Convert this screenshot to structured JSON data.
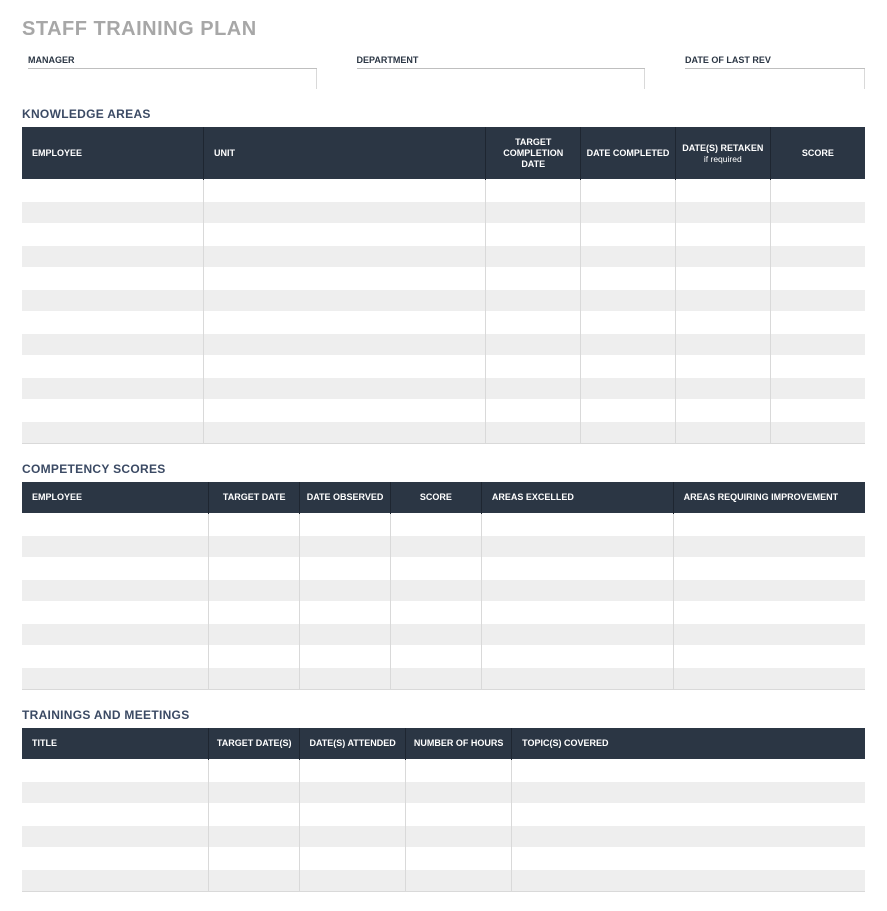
{
  "title": "STAFF TRAINING PLAN",
  "meta": {
    "manager_label": "MANAGER",
    "manager_value": "",
    "department_label": "DEPARTMENT",
    "department_value": "",
    "lastrev_label": "DATE OF LAST REV",
    "lastrev_value": ""
  },
  "knowledge": {
    "heading": "KNOWLEDGE AREAS",
    "headers": {
      "employee": "EMPLOYEE",
      "unit": "UNIT",
      "target_completion": "TARGET COMPLETION DATE",
      "date_completed": "DATE COMPLETED",
      "dates_retaken": "DATE(S) RETAKEN",
      "dates_retaken_sub": "if required",
      "score": "SCORE"
    },
    "rows": [
      {
        "employee": "",
        "unit": "",
        "target": "",
        "completed": "",
        "retaken": "",
        "score": ""
      },
      {
        "employee": "",
        "unit": "",
        "target": "",
        "completed": "",
        "retaken": "",
        "score": ""
      },
      {
        "employee": "",
        "unit": "",
        "target": "",
        "completed": "",
        "retaken": "",
        "score": ""
      },
      {
        "employee": "",
        "unit": "",
        "target": "",
        "completed": "",
        "retaken": "",
        "score": ""
      },
      {
        "employee": "",
        "unit": "",
        "target": "",
        "completed": "",
        "retaken": "",
        "score": ""
      },
      {
        "employee": "",
        "unit": "",
        "target": "",
        "completed": "",
        "retaken": "",
        "score": ""
      },
      {
        "employee": "",
        "unit": "",
        "target": "",
        "completed": "",
        "retaken": "",
        "score": ""
      },
      {
        "employee": "",
        "unit": "",
        "target": "",
        "completed": "",
        "retaken": "",
        "score": ""
      },
      {
        "employee": "",
        "unit": "",
        "target": "",
        "completed": "",
        "retaken": "",
        "score": ""
      },
      {
        "employee": "",
        "unit": "",
        "target": "",
        "completed": "",
        "retaken": "",
        "score": ""
      },
      {
        "employee": "",
        "unit": "",
        "target": "",
        "completed": "",
        "retaken": "",
        "score": ""
      },
      {
        "employee": "",
        "unit": "",
        "target": "",
        "completed": "",
        "retaken": "",
        "score": ""
      }
    ]
  },
  "competency": {
    "heading": "COMPETENCY SCORES",
    "headers": {
      "employee": "EMPLOYEE",
      "target_date": "TARGET DATE",
      "date_observed": "DATE OBSERVED",
      "score": "SCORE",
      "areas_excelled": "AREAS EXCELLED",
      "areas_improve": "AREAS REQUIRING IMPROVEMENT"
    },
    "rows": [
      {
        "employee": "",
        "target": "",
        "observed": "",
        "score": "",
        "excelled": "",
        "improve": ""
      },
      {
        "employee": "",
        "target": "",
        "observed": "",
        "score": "",
        "excelled": "",
        "improve": ""
      },
      {
        "employee": "",
        "target": "",
        "observed": "",
        "score": "",
        "excelled": "",
        "improve": ""
      },
      {
        "employee": "",
        "target": "",
        "observed": "",
        "score": "",
        "excelled": "",
        "improve": ""
      },
      {
        "employee": "",
        "target": "",
        "observed": "",
        "score": "",
        "excelled": "",
        "improve": ""
      },
      {
        "employee": "",
        "target": "",
        "observed": "",
        "score": "",
        "excelled": "",
        "improve": ""
      },
      {
        "employee": "",
        "target": "",
        "observed": "",
        "score": "",
        "excelled": "",
        "improve": ""
      },
      {
        "employee": "",
        "target": "",
        "observed": "",
        "score": "",
        "excelled": "",
        "improve": ""
      }
    ]
  },
  "trainings": {
    "heading": "TRAININGS AND MEETINGS",
    "headers": {
      "title": "TITLE",
      "target_dates": "TARGET DATE(S)",
      "dates_attended": "DATE(S) ATTENDED",
      "hours": "NUMBER OF HOURS",
      "topics": "TOPIC(S) COVERED"
    },
    "rows": [
      {
        "title": "",
        "target": "",
        "attended": "",
        "hours": "",
        "topics": ""
      },
      {
        "title": "",
        "target": "",
        "attended": "",
        "hours": "",
        "topics": ""
      },
      {
        "title": "",
        "target": "",
        "attended": "",
        "hours": "",
        "topics": ""
      },
      {
        "title": "",
        "target": "",
        "attended": "",
        "hours": "",
        "topics": ""
      },
      {
        "title": "",
        "target": "",
        "attended": "",
        "hours": "",
        "topics": ""
      },
      {
        "title": "",
        "target": "",
        "attended": "",
        "hours": "",
        "topics": ""
      }
    ]
  }
}
